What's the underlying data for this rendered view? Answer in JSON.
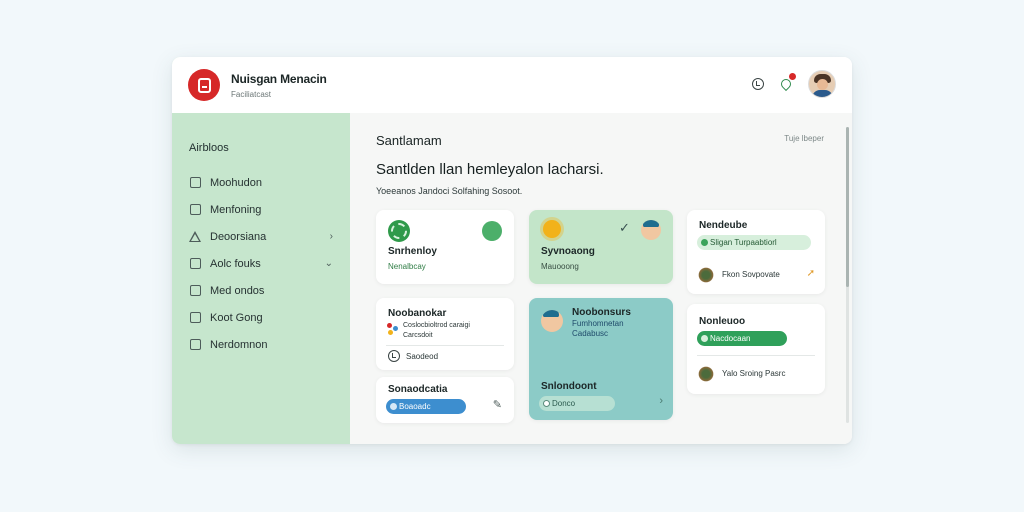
{
  "app": {
    "title": "Nuisgan Menacin",
    "subtitle": "Faciliatcast"
  },
  "sidebar": {
    "section_label": "Airbloos",
    "items": [
      {
        "label": "Moohudon",
        "icon": "document-icon"
      },
      {
        "label": "Menfoning",
        "icon": "document-icon"
      },
      {
        "label": "Deoorsiana",
        "icon": "warning-triangle-icon",
        "chevron": "›"
      },
      {
        "label": "Aolc fouks",
        "icon": "calendar-icon",
        "chevron": "⌄"
      },
      {
        "label": "Med ondos",
        "icon": "checklist-icon"
      },
      {
        "label": "Koot Gong",
        "icon": "note-icon"
      },
      {
        "label": "Nerdomnon",
        "icon": "checkbox-icon"
      }
    ]
  },
  "header": {
    "icons": [
      "clock-icon",
      "notification-icon",
      "user-avatar"
    ]
  },
  "main": {
    "title": "Santlamam",
    "top_link": "Tuje lbeper",
    "heading": "Santlden llan hemleyalon lacharsi.",
    "subheading": "Yoeeanos Jandoci  Solfahing Sosoot."
  },
  "cards": [
    {
      "title": "Snrhenloy",
      "subtitle": "Nenalbcay",
      "icon": "gear-icon",
      "status_icon": "green-check-icon"
    },
    {
      "title": "Syvnoaong",
      "subtitle": "Mauooong",
      "icon": "sun-icon",
      "status_icon": "checkmark-icon",
      "avatar_icon": "person-icon"
    },
    {
      "title": "Nendeube",
      "pill": "Sligan Turpaabtiorl",
      "row": "Fkon Sovpovate",
      "icon": "leaf-icon",
      "row_icon": "plant-icon",
      "arrow_icon": "arrow-icon"
    },
    {
      "title": "Noobanokar",
      "rows": [
        "Coslocbioltrod caraigi",
        "Carcsdoit"
      ],
      "extra_row": "Saodeod",
      "icon": "apps-icon",
      "row_icon": "clock-icon"
    },
    {
      "title": "Noobonsurs",
      "rows": [
        "Fumhomnetan",
        "Cadabusc"
      ],
      "icon": "person-icon"
    },
    {
      "title": "Nonleuoo",
      "pill": "Nacdocaan",
      "row": "Yalo Sroing Pasrc",
      "icon": "leaf-icon",
      "row_icon": "plant-icon"
    },
    {
      "title": "Sonaodcatia",
      "pill": "Boaoadc",
      "icon": "edit-icon"
    },
    {
      "title": "Snlondoont",
      "pill": "Donco",
      "icon": "chevron-icon"
    }
  ],
  "colors": {
    "brand_red": "#d62828",
    "sidebar_green": "#c6e6cd",
    "accent_green": "#2f9a4a",
    "accent_blue": "#3d8ecf",
    "teal_card": "#8ccbc7"
  }
}
